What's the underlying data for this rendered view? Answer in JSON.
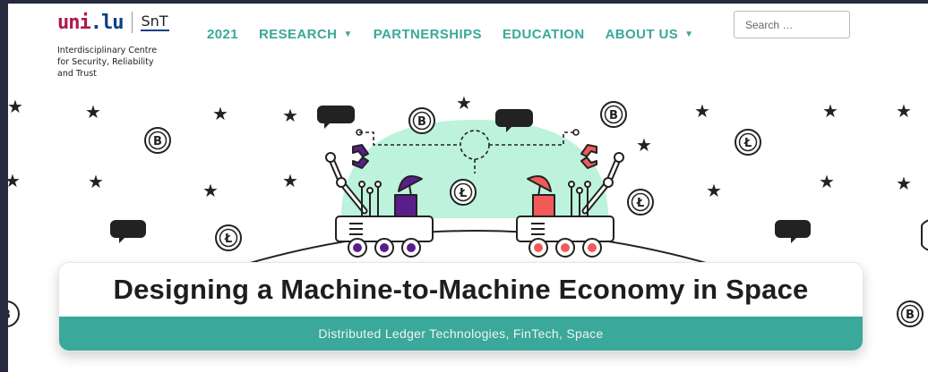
{
  "header": {
    "logo": {
      "uni_part1": "uni",
      "uni_part2": ".lu",
      "snt": "SnT",
      "subtitle_line1": "Interdisciplinary Centre",
      "subtitle_line2": "for Security, Reliability",
      "subtitle_line3": "and Trust"
    },
    "nav": [
      {
        "label": "2021",
        "has_dropdown": false
      },
      {
        "label": "RESEARCH",
        "has_dropdown": true
      },
      {
        "label": "PARTNERSHIPS",
        "has_dropdown": false
      },
      {
        "label": "EDUCATION",
        "has_dropdown": false
      },
      {
        "label": "ABOUT US",
        "has_dropdown": true
      }
    ],
    "caret_glyph": "▼",
    "search": {
      "placeholder": "Search …",
      "value": ""
    }
  },
  "hero": {
    "title": "Designing a Machine-to-Machine Economy in Space",
    "subtitle": "Distributed Ledger Technologies, FinTech, Space",
    "coin_bitcoin_glyph": "B",
    "coin_litecoin_glyph": "Ł"
  },
  "colors": {
    "accent": "#3aa89a",
    "logo_red": "#b0174a",
    "logo_blue": "#0b3f86",
    "robot_left_accent": "#5a1e8c",
    "robot_right_accent": "#f25a5a",
    "planet_glow": "#bdf2dd",
    "frame": "#252a3f"
  }
}
